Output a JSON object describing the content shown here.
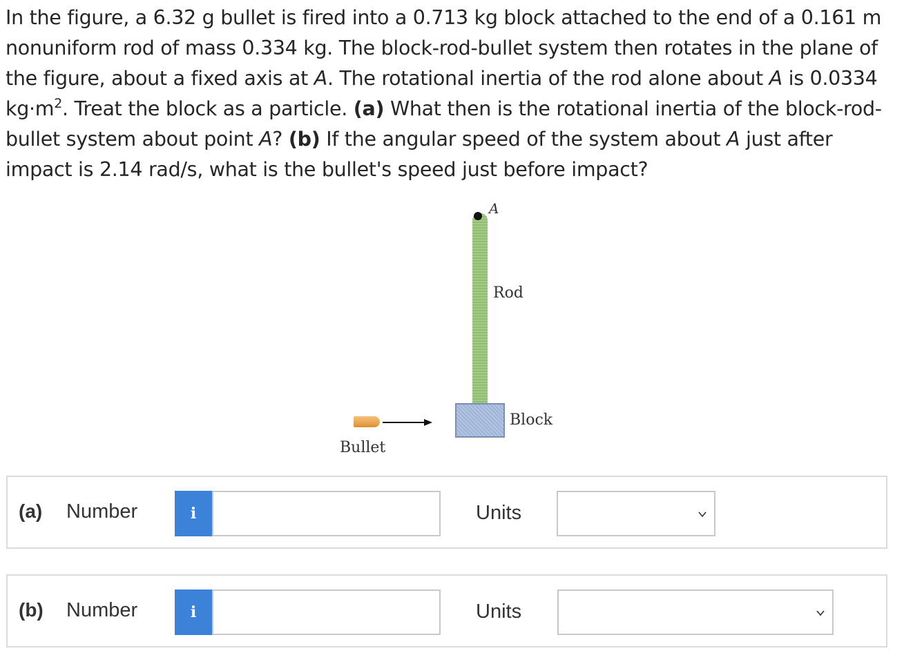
{
  "problem": {
    "t1": "In the figure, a 6.32 g bullet is fired into a 0.713 kg block attached to the end of a 0.161 m nonuniform rod of mass 0.334 kg. The block-rod-bullet system then rotates in the plane of the figure, about a fixed axis at ",
    "axis1": "A",
    "t2": ". The rotational inertia of the rod alone about ",
    "axis2": "A",
    "t3": " is 0.0334 kg·m",
    "sup": "2",
    "t4": ". Treat the block as a particle. ",
    "part_a_tag": "(a)",
    "t5": " What then is the rotational inertia of the block-rod-bullet system about point ",
    "axis3": "A",
    "t6": "? ",
    "part_b_tag": "(b)",
    "t7": " If the angular speed of the system about ",
    "axis4": "A",
    "t8": " just after impact is 2.14 rad/s, what is the bullet's speed just before impact?"
  },
  "figure": {
    "pivot_label": "A",
    "rod_label": "Rod",
    "block_label": "Block",
    "bullet_label": "Bullet",
    "colors": {
      "rod": "#a4cc86",
      "block": "#b3c5e3",
      "bullet": "#e9a64f"
    }
  },
  "answers": [
    {
      "part": "(a)",
      "number_label": "Number",
      "info_icon": "i",
      "value": "",
      "units_label": "Units",
      "units_value": ""
    },
    {
      "part": "(b)",
      "number_label": "Number",
      "info_icon": "i",
      "value": "",
      "units_label": "Units",
      "units_value": ""
    }
  ],
  "colors": {
    "info_button": "#3c82d8",
    "border": "#dcdcdc"
  }
}
